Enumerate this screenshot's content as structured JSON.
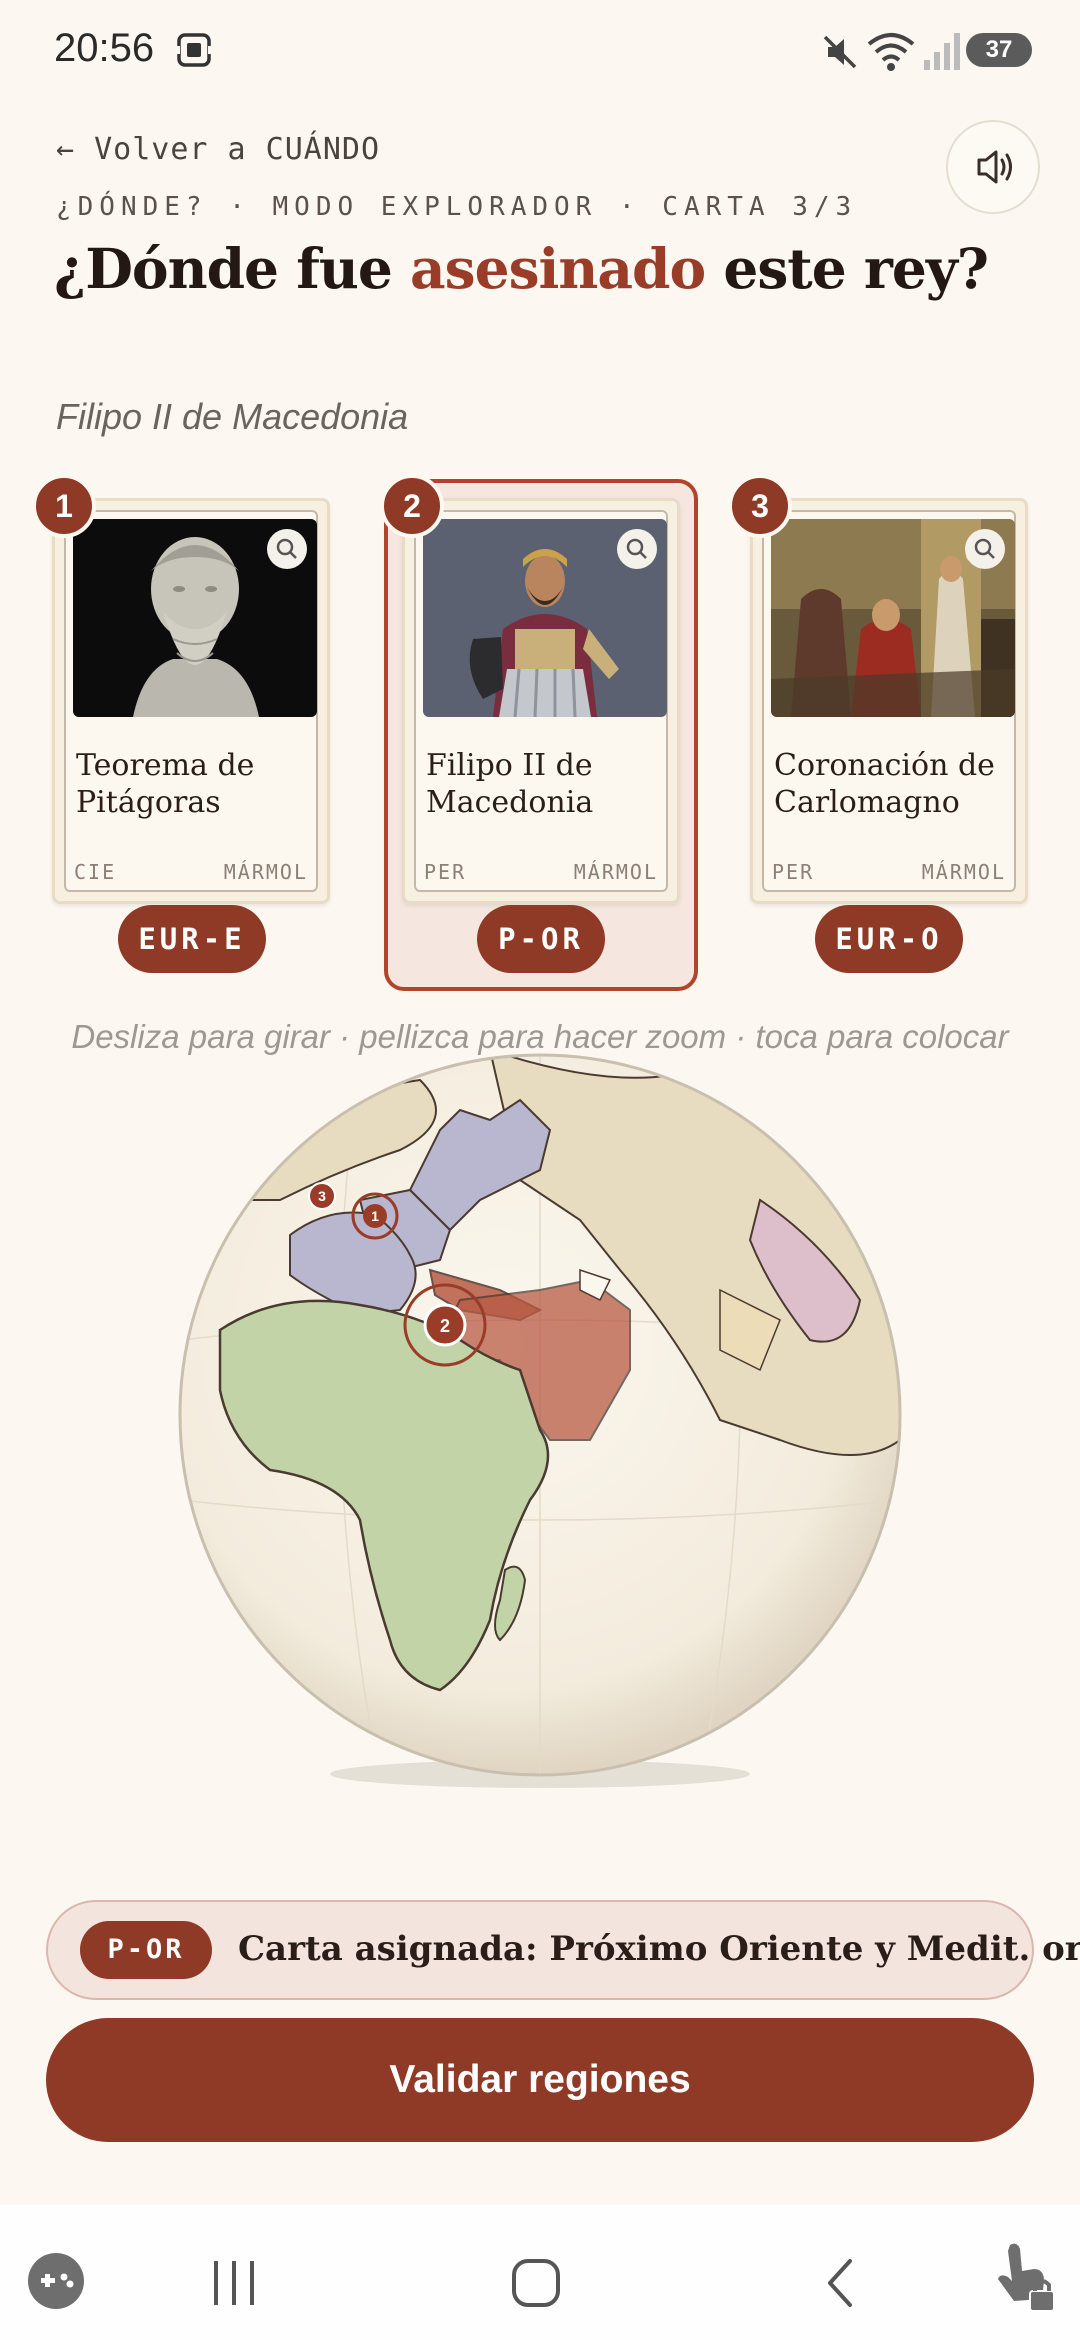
{
  "status_bar": {
    "time": "20:56",
    "battery": "37"
  },
  "header": {
    "back_label": "← Volver a CUÁNDO",
    "meta": "¿DÓNDE? · MODO EXPLORADOR · CARTA 3/3",
    "question_pre": "¿Dónde fue ",
    "question_accent": "asesinado",
    "question_post": " este rey?",
    "subject": "Filipo II de Macedonia"
  },
  "colors": {
    "accent": "#8f3a26",
    "background": "#fcf8f1",
    "africa": "#c2d3a8",
    "europe_region": "#b9b6cf",
    "near_east_region": "#b85b44"
  },
  "cards": [
    {
      "number": "1",
      "title": "Teorema de Pitágoras",
      "category": "CIE",
      "material": "MÁRMOL",
      "region": "EUR-E",
      "selected": false
    },
    {
      "number": "2",
      "title": "Filipo II de Macedonia",
      "category": "PER",
      "material": "MÁRMOL",
      "region": "P-OR",
      "selected": true
    },
    {
      "number": "3",
      "title": "Coronación de Carlomagno",
      "category": "PER",
      "material": "MÁRMOL",
      "region": "EUR-O",
      "selected": false
    }
  ],
  "hint": "Desliza para girar · pellizca para hacer zoom · toca para colocar",
  "globe": {
    "markers": [
      "1",
      "2",
      "3"
    ],
    "icon": "globe-map"
  },
  "assigned": {
    "code": "P-OR",
    "text": "Carta asignada: Próximo Oriente y Medit. or."
  },
  "validate_label": "Validar regiones",
  "icons": [
    "screenshot-icon",
    "mute-icon",
    "wifi-icon",
    "signal-icon",
    "sound-icon",
    "search-icon",
    "game-icon",
    "recents-icon",
    "home-icon",
    "back-icon",
    "touch-lock-icon"
  ]
}
